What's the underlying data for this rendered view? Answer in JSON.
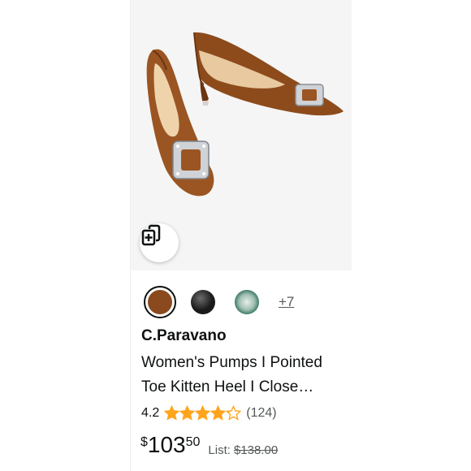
{
  "product": {
    "brand": "C.Paravano",
    "title_line1": "Women's Pumps I Pointed",
    "title_line2": "Toe Kitten Heel I Close…",
    "rating": "4.2",
    "rating_value": 4.2,
    "rating_max": 5,
    "review_count": "(124)",
    "price": {
      "symbol": "$",
      "whole": "103",
      "fraction": "50",
      "list_label": "List:",
      "list_price": "$138.00"
    }
  },
  "swatches": {
    "items": [
      {
        "name": "brown",
        "color": "#8a4a1e",
        "selected": true
      },
      {
        "name": "black",
        "color": "#1a1a1a",
        "selected": false
      },
      {
        "name": "green",
        "color": "#2f6f5a",
        "selected": false
      }
    ],
    "more_label": "+7"
  },
  "colors": {
    "star": "#ffa41c",
    "text": "#0f1111",
    "muted": "#565959",
    "image_bg": "#f5f5f5",
    "shoe": "#9a5523"
  },
  "icons": {
    "ar_button": "view-in-3d-icon",
    "star": "star-icon"
  }
}
